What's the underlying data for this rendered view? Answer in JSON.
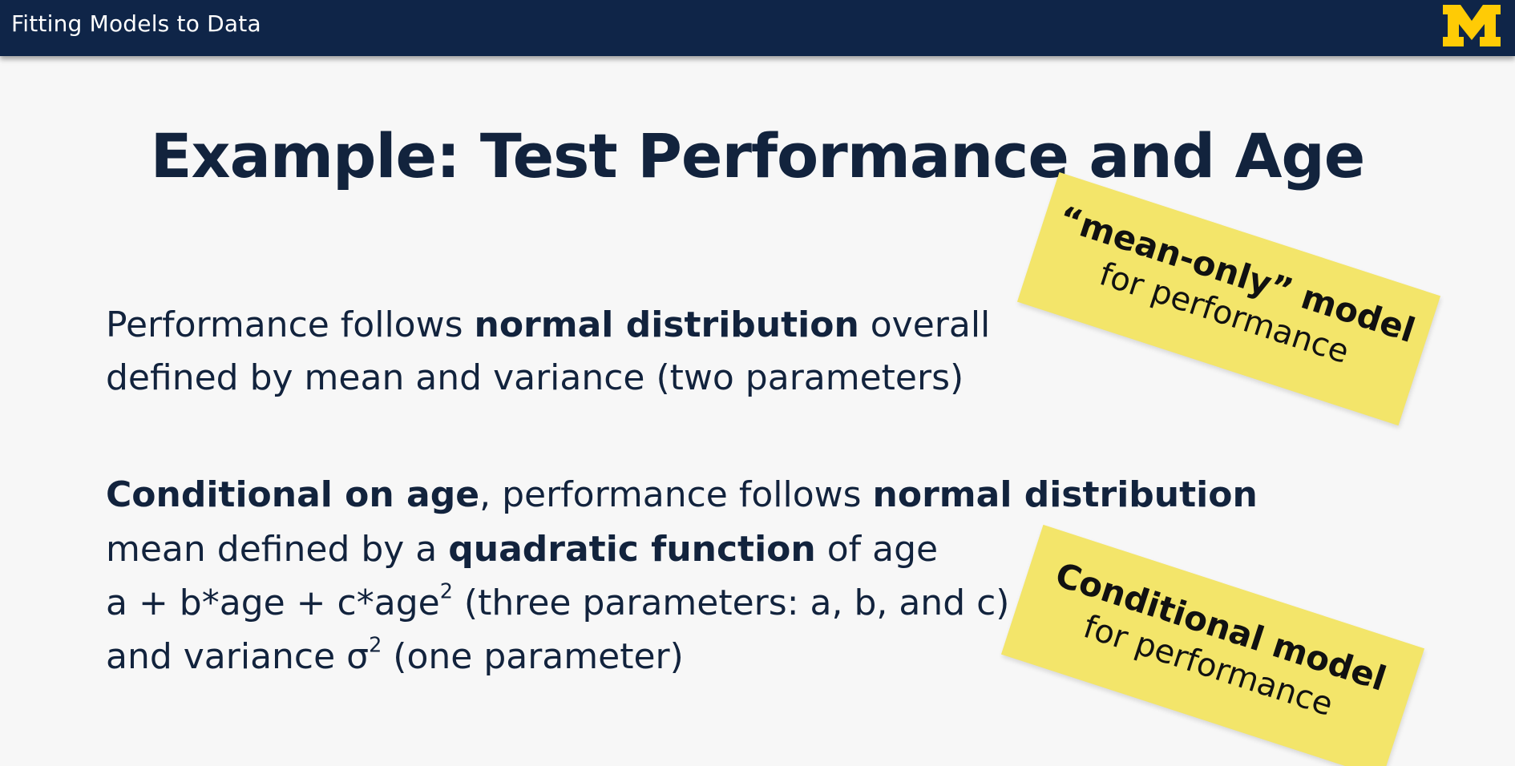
{
  "header": {
    "course_title": "Fitting Models to Data",
    "logo_letter": "M",
    "colors": {
      "bar": "#0f2548",
      "logo": "#ffcb05"
    }
  },
  "slide": {
    "title": "Example: Test Performance and Age",
    "block1": {
      "line1_a": "Performance follows ",
      "line1_b": "normal distribution",
      "line1_c": " overall",
      "line2": "defined by mean and variance (two parameters)"
    },
    "block2": {
      "line1_a": "Conditional on age",
      "line1_b": ", performance follows ",
      "line1_c": "normal distribution",
      "line2_a": "mean defined by a ",
      "line2_b": "quadratic function",
      "line2_c": " of age",
      "line3_a": "a + b*age + c*age",
      "line3_sup": "2",
      "line3_b": " (three parameters: a, b, and c)",
      "line4_a": "and variance σ",
      "line4_sup": "2",
      "line4_b": " (one parameter)"
    }
  },
  "notes": [
    {
      "line1": "“mean-only” model",
      "line2": "for performance"
    },
    {
      "line1": "Conditional model",
      "line2": "for performance"
    }
  ],
  "note_color": "#f3e56a"
}
